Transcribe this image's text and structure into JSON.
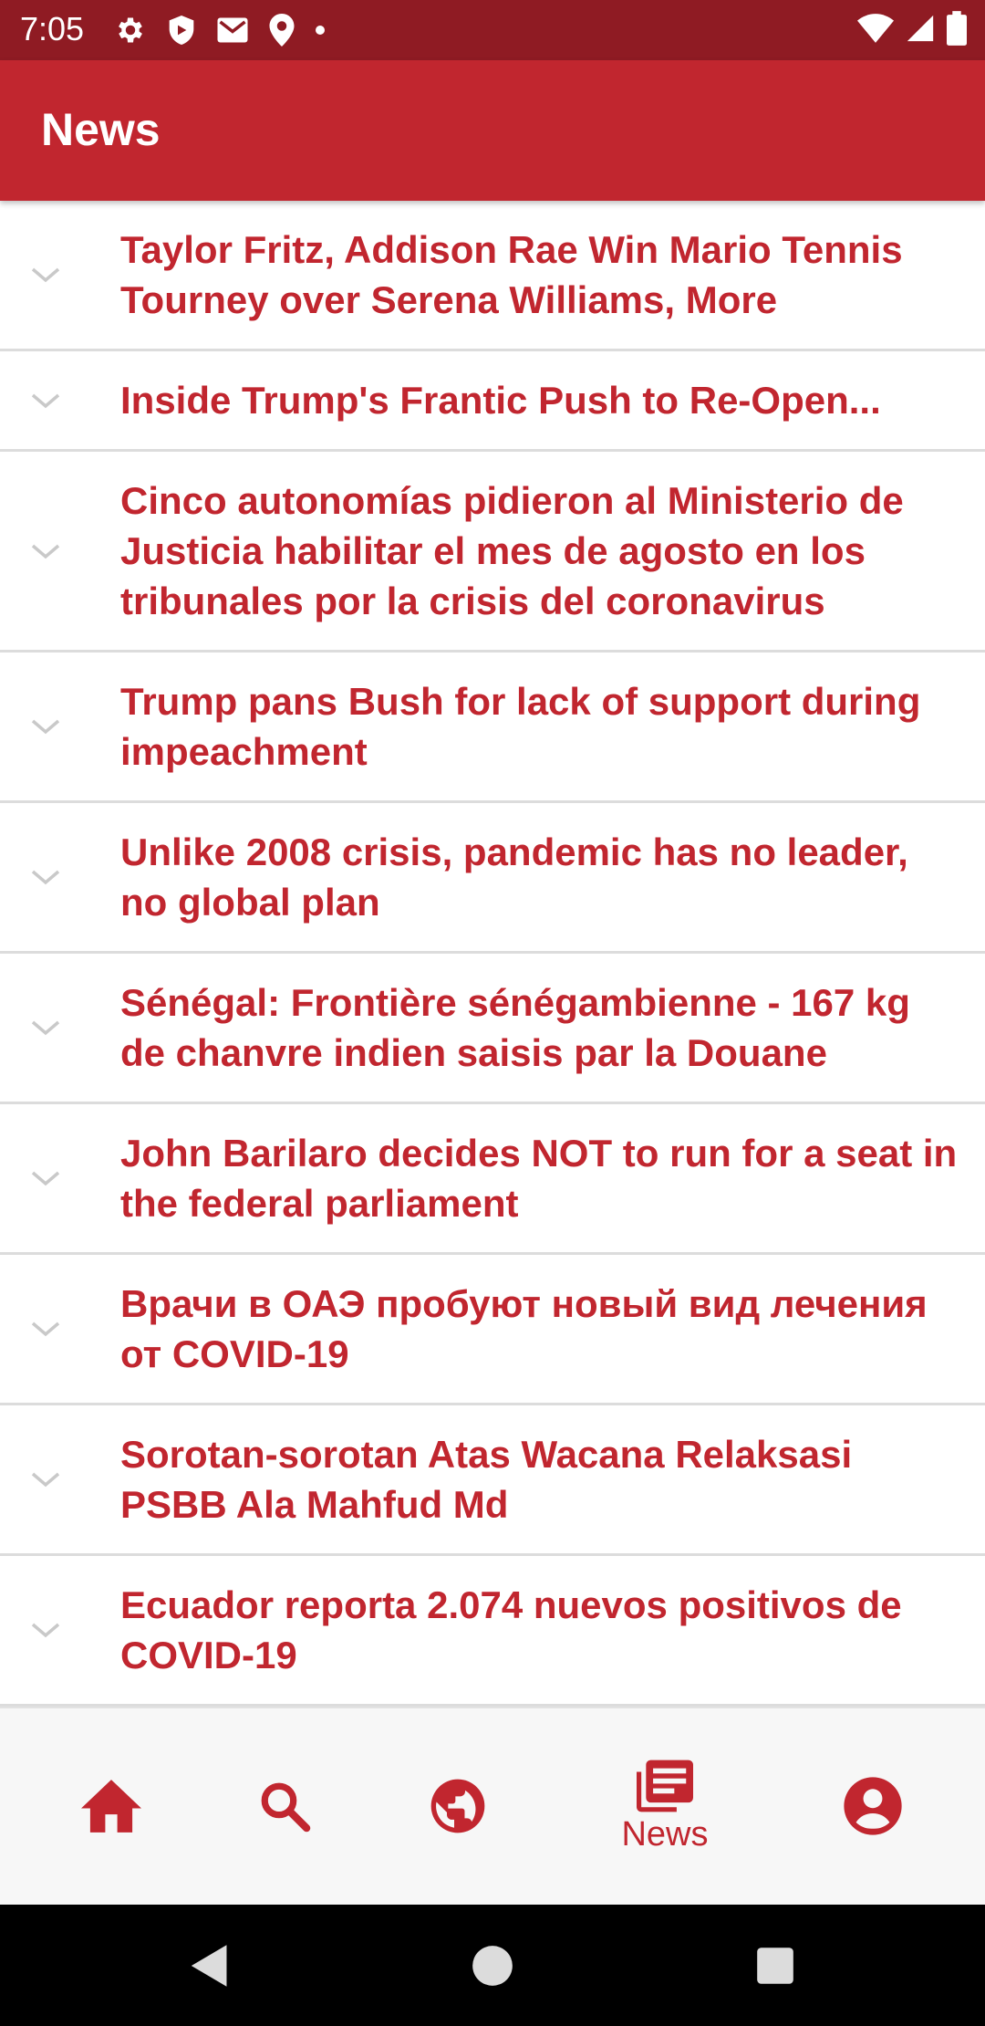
{
  "status_bar": {
    "time": "7:05",
    "left_icons": [
      "settings-icon",
      "shield-icon",
      "gmail-icon",
      "location-icon",
      "dot-icon"
    ],
    "right_icons": [
      "wifi-icon",
      "cellular-icon",
      "battery-icon"
    ]
  },
  "app_bar": {
    "title": "News"
  },
  "colors": {
    "accent": "#c1262f",
    "status_bar": "#8f1b23",
    "divider": "#dcdcdc",
    "bottom_nav_bg": "#f7f7f7"
  },
  "news": [
    {
      "headline": "Taylor Fritz, Addison Rae Win Mario Tennis Tourney over Serena Williams, More"
    },
    {
      "headline": "Inside Trump's Frantic Push to Re-Open..."
    },
    {
      "headline": "Cinco autonomías pidieron al Ministerio de Justicia habilitar el mes de agosto en los tribunales por la crisis del coronavirus"
    },
    {
      "headline": "Trump pans Bush for lack of support during impeachment"
    },
    {
      "headline": "Unlike 2008 crisis, pandemic has no leader, no global plan"
    },
    {
      "headline": "Sénégal: Frontière sénégambienne - 167 kg de chanvre indien saisis par la Douane"
    },
    {
      "headline": "John Barilaro decides NOT to run for a seat in the federal parliament"
    },
    {
      "headline": "Врачи в ОАЭ пробуют новый вид лечения от COVID-19"
    },
    {
      "headline": "Sorotan-sorotan Atas Wacana Relaksasi PSBB Ala Mahfud Md"
    },
    {
      "headline": "Ecuador reporta 2.074 nuevos positivos de COVID-19"
    }
  ],
  "bottom_nav": {
    "items": [
      {
        "icon": "home-icon",
        "label": ""
      },
      {
        "icon": "search-icon",
        "label": ""
      },
      {
        "icon": "globe-icon",
        "label": ""
      },
      {
        "icon": "news-icon",
        "label": "News",
        "selected": true
      },
      {
        "icon": "account-icon",
        "label": ""
      }
    ]
  },
  "system_nav": [
    "back-button",
    "home-button",
    "recents-button"
  ]
}
